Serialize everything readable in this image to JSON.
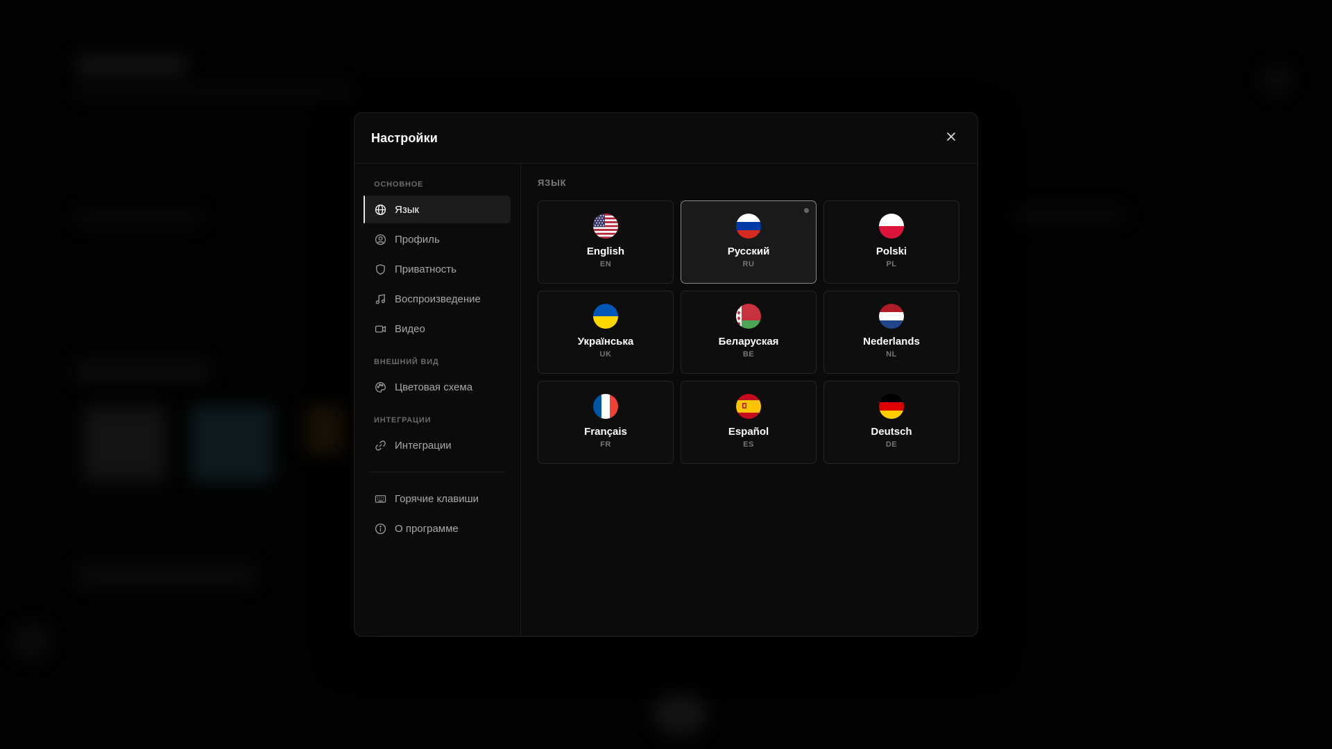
{
  "modal": {
    "title": "Настройки"
  },
  "sidebar": {
    "sections": [
      {
        "label": "Основное"
      },
      {
        "label": "Внешний вид"
      },
      {
        "label": "Интеграции"
      }
    ],
    "items": [
      {
        "label": "Язык",
        "icon": "globe-icon",
        "active": true
      },
      {
        "label": "Профиль",
        "icon": "user-circle-icon"
      },
      {
        "label": "Приватность",
        "icon": "shield-icon"
      },
      {
        "label": "Воспроизведение",
        "icon": "music-note-icon"
      },
      {
        "label": "Видео",
        "icon": "video-camera-icon"
      },
      {
        "label": "Цветовая схема",
        "icon": "palette-icon"
      },
      {
        "label": "Интеграции",
        "icon": "link-icon"
      },
      {
        "label": "Горячие клавиши",
        "icon": "keyboard-icon"
      },
      {
        "label": "О программе",
        "icon": "info-icon"
      }
    ]
  },
  "content": {
    "section_label": "Язык",
    "languages": [
      {
        "name": "English",
        "code": "EN",
        "flag": "us-flag-icon"
      },
      {
        "name": "Русский",
        "code": "RU",
        "flag": "ru-flag-icon",
        "selected": true
      },
      {
        "name": "Polski",
        "code": "PL",
        "flag": "pl-flag-icon"
      },
      {
        "name": "Українська",
        "code": "UK",
        "flag": "ua-flag-icon"
      },
      {
        "name": "Беларуская",
        "code": "BE",
        "flag": "by-flag-icon"
      },
      {
        "name": "Nederlands",
        "code": "NL",
        "flag": "nl-flag-icon"
      },
      {
        "name": "Français",
        "code": "FR",
        "flag": "fr-flag-icon"
      },
      {
        "name": "Español",
        "code": "ES",
        "flag": "es-flag-icon"
      },
      {
        "name": "Deutsch",
        "code": "DE",
        "flag": "de-flag-icon"
      }
    ]
  },
  "colors": {
    "background": "#000000",
    "modal": "#0b0b0b",
    "selected_card": "#1a1a1a",
    "accent": "#ffffff"
  }
}
